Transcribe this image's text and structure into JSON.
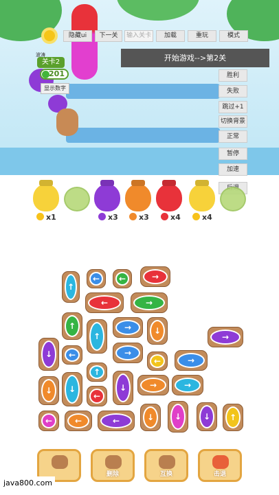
{
  "toolbar": {
    "hide_ui": "隐藏ui",
    "next_level": "下一关",
    "level_input_placeholder": "输入关卡",
    "load": "加载",
    "replay": "重玩",
    "mode": "模式"
  },
  "banner": "开始游戏-->第2关",
  "right_buttons": [
    "胜利",
    "失败",
    "跳过+1",
    "切换背景",
    "正常",
    "暂停",
    "加速",
    "后退"
  ],
  "hud": {
    "small_label": "波涛",
    "level": "关卡2",
    "coins": "201",
    "show_numbers": "显示数字"
  },
  "jars": [
    {
      "color": "#f7d23a",
      "count": "x1",
      "dot": "#f7c21a"
    },
    {
      "color": "#8e3bd6",
      "count": "x3",
      "dot": "#8e3bd6"
    },
    {
      "color": "#f08a2b",
      "count": "x3",
      "dot": "#f08a2b"
    },
    {
      "color": "#e8323a",
      "count": "x4",
      "dot": "#e8323a"
    },
    {
      "color": "#f7d23a",
      "count": "x4",
      "dot": "#f7c21a"
    }
  ],
  "bottom_buttons": [
    "",
    "删除",
    "互换",
    "击退"
  ],
  "watermark": "java800.com",
  "colors": {
    "blue": "#3b8ee8",
    "red": "#e8323a",
    "green": "#35b444",
    "purple": "#8e3bd6",
    "orange": "#f08a2b",
    "yellow": "#f2c41b",
    "cyan": "#2bb6e0",
    "pink": "#e03fc8"
  }
}
